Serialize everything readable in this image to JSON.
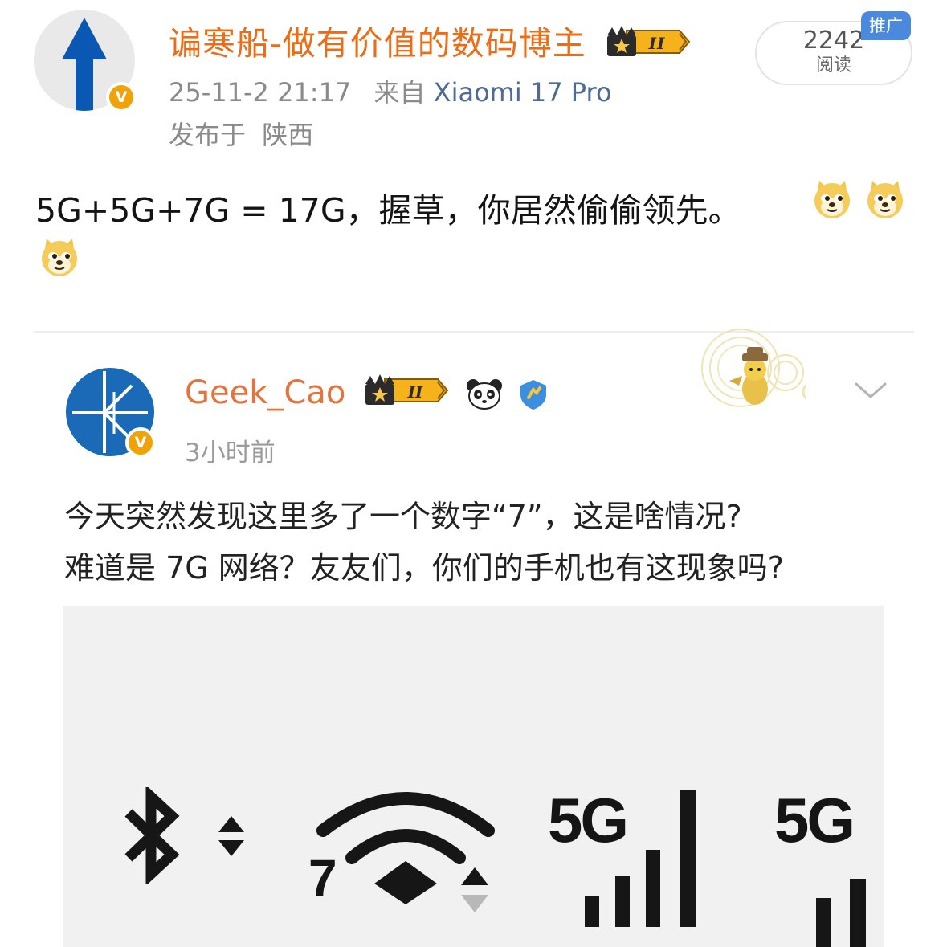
{
  "author": {
    "name": "谝寒船-做有价值的数码博主",
    "date": "25-11-2 21:17",
    "from_prefix": "来自",
    "device": "Xiaomi 17 Pro",
    "location_prefix": "发布于",
    "location": "陕西",
    "verified_mark": "V",
    "level_badge": "II"
  },
  "stats": {
    "read_count": "2242",
    "read_label": "阅读",
    "promo_tag": "推广"
  },
  "post": {
    "text": "5G+5G+7G = 17G，握草，你居然偷偷领先。",
    "emoji": "doge"
  },
  "retweet": {
    "author": "Geek_Cao",
    "time": "3小时前",
    "verified_mark": "V",
    "level_badge": "II",
    "line1": "今天突然发现这里多了一个数字“7”，这是啥情况?",
    "line2": "难道是 7G 网络？友友们，你们的手机也有这现象吗?",
    "screenshot": {
      "wifi_label": "7",
      "sim1_label": "5G",
      "sim2_label": "5G"
    }
  },
  "colors": {
    "author_orange": "#ef6b14",
    "device_blue": "#4f6b94",
    "promo_blue": "#4a89dc",
    "verified_orange": "#f0a20a"
  }
}
